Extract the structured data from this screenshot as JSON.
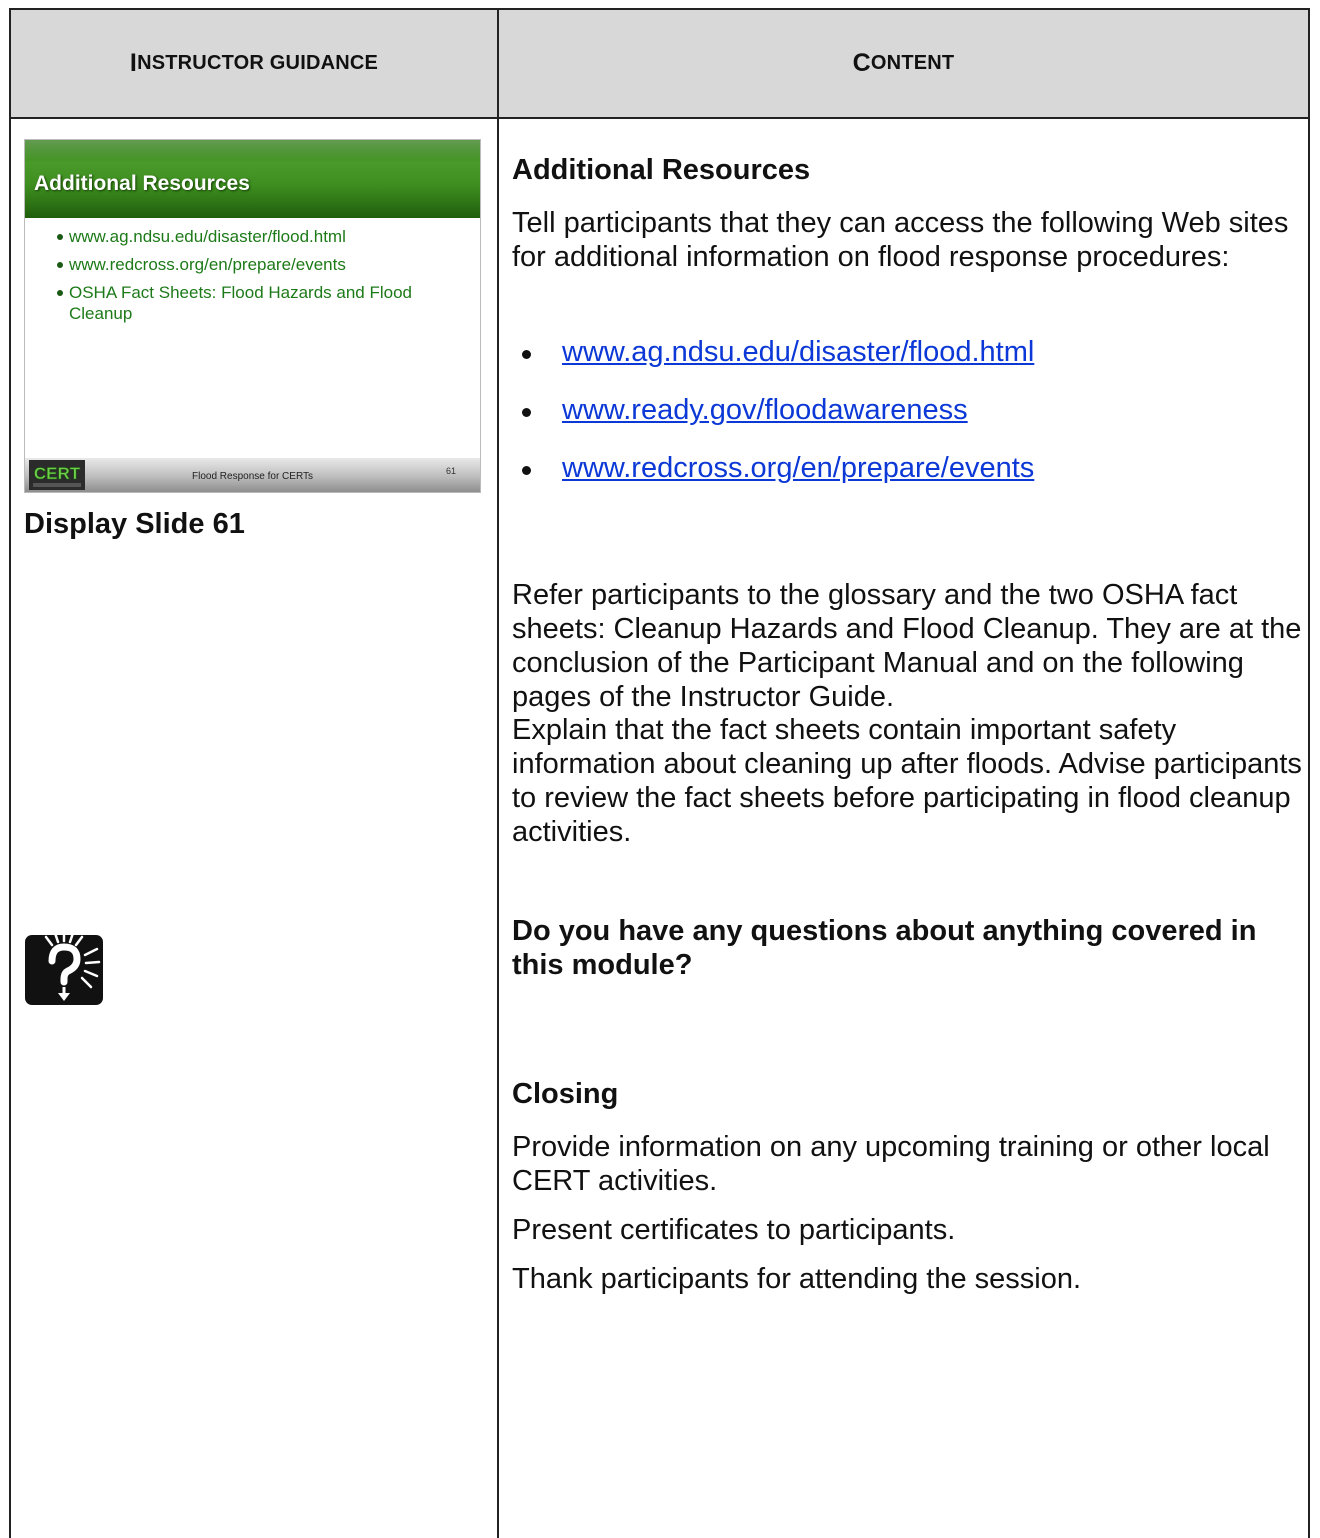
{
  "header": {
    "left_cap": "I",
    "left_rest": "nstructor guidance",
    "right_cap": "C",
    "right_rest": "ontent"
  },
  "slide": {
    "title": "Additional Resources",
    "bullets": [
      "www.ag.ndsu.edu/disaster/flood.html",
      "www.redcross.org/en/prepare/events",
      "OSHA Fact Sheets: Flood Hazards and Flood Cleanup"
    ],
    "logo_text": "CERT",
    "footer": "Flood Response for CERTs",
    "number": "61",
    "caption": "Display Slide 61",
    "colors": {
      "band": "#3d8c1f",
      "bullet_text": "#1d7a18"
    }
  },
  "question_icon": "question-mark-icon",
  "content": {
    "resources_heading": "Additional Resources",
    "resources_intro": "Tell participants that they can access the following Web sites for additional information on flood response procedures:",
    "links": [
      "www.ag.ndsu.edu/disaster/flood.html",
      "www.ready.gov/floodawareness",
      "www.redcross.org/en/prepare/events"
    ],
    "refer_text": "Refer participants to the glossary and the two OSHA fact sheets: Cleanup Hazards and Flood Cleanup. They are at the conclusion of the Participant Manual and on the following pages of the Instructor Guide.",
    "explain_text": "Explain that the fact sheets contain important safety information about cleaning up after floods. Advise participants to review the fact sheets before participating in flood cleanup activities.",
    "question_text": "Do you have any questions about anything covered in this module?",
    "closing_heading": "Closing",
    "closing_items": [
      "Provide information on any upcoming training or other local CERT activities.",
      "Present certificates to participants.",
      "Thank participants for attending the session."
    ],
    "link_color": "#0b38d6"
  }
}
